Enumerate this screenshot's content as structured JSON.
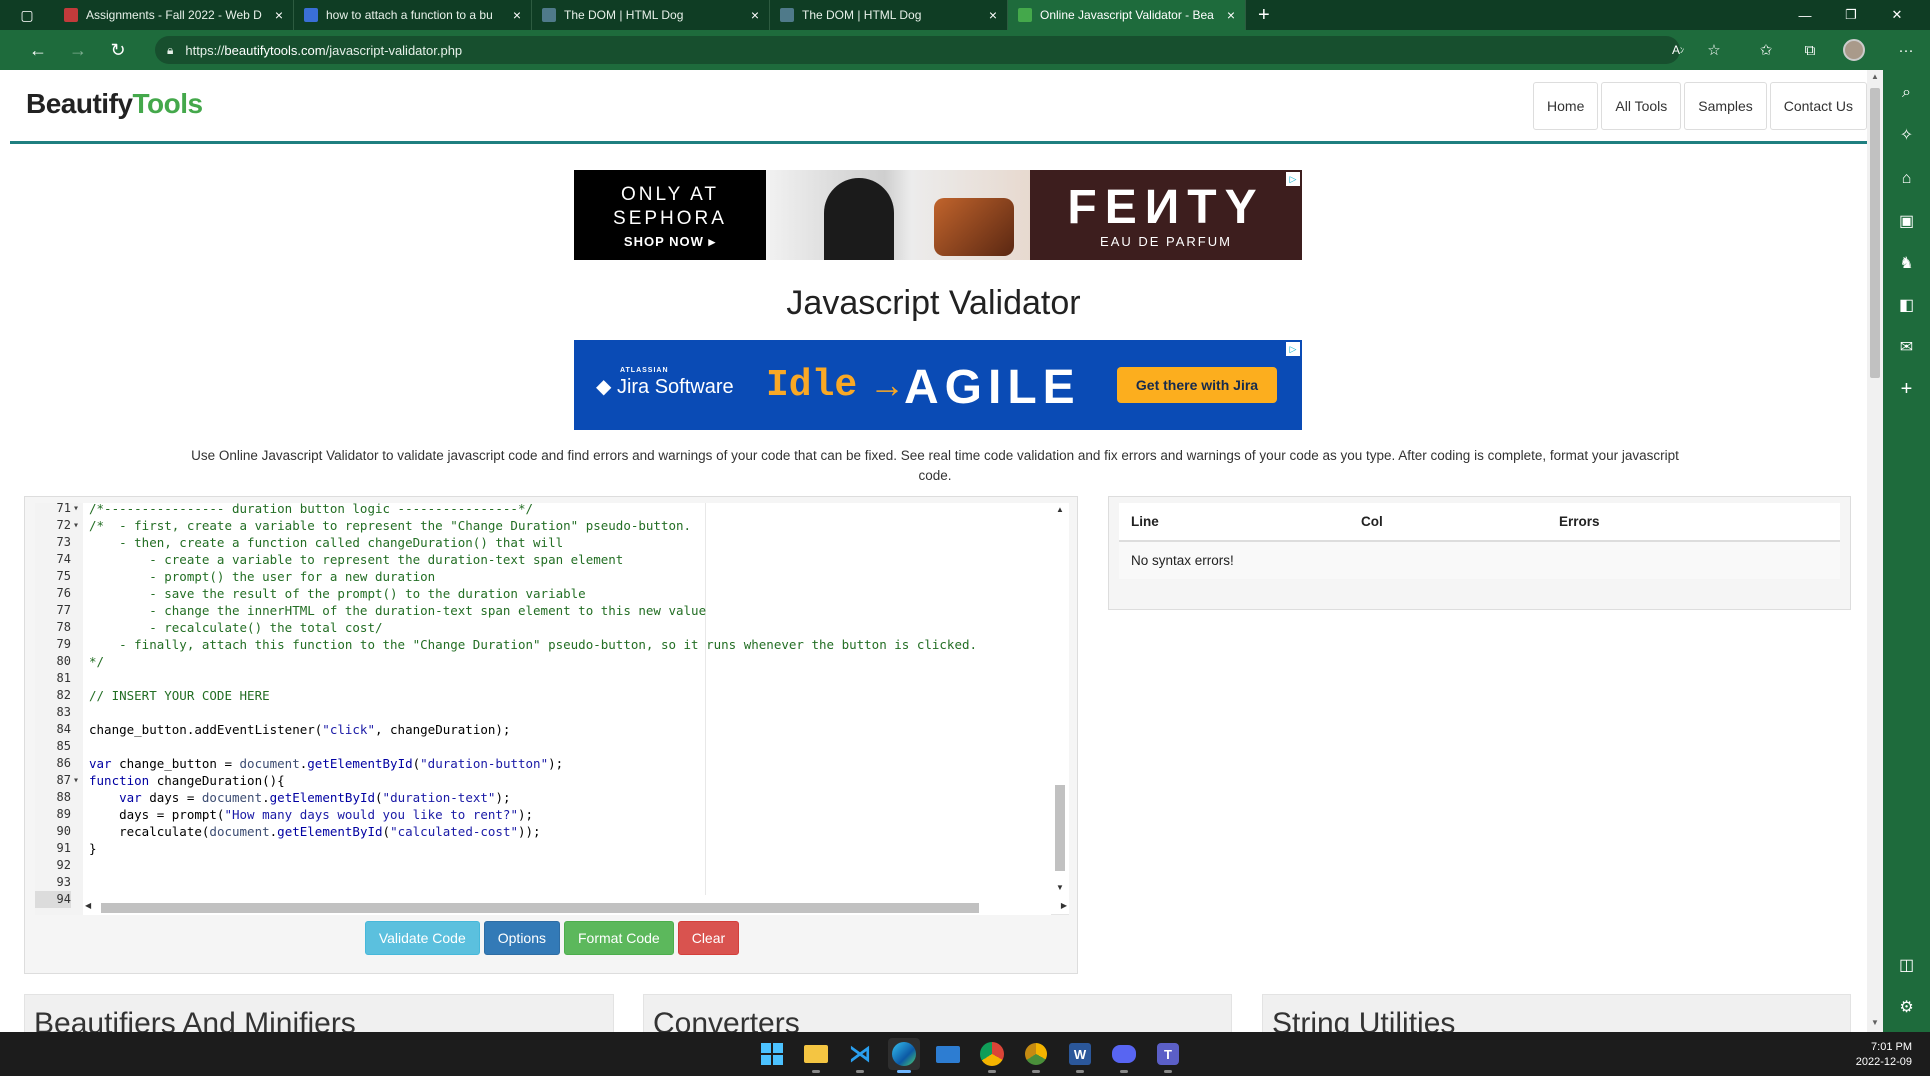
{
  "browser": {
    "tabs": [
      {
        "title": "Assignments - Fall 2022 - Web D",
        "favicon_color": "#c23b3b",
        "active": false
      },
      {
        "title": "how to attach a function to a bu",
        "favicon_color": "#3a6fd6",
        "active": false
      },
      {
        "title": "The DOM | HTML Dog",
        "favicon_color": "#4f7a8a",
        "active": false
      },
      {
        "title": "The DOM | HTML Dog",
        "favicon_color": "#4f7a8a",
        "active": false
      },
      {
        "title": "Online Javascript Validator - Bea",
        "favicon_color": "#44a84b",
        "active": true
      }
    ],
    "url_prefix": "https://",
    "url_host": "beautifytools.com",
    "url_path": "/javascript-validator.php"
  },
  "site": {
    "logo_part1": "Beautify",
    "logo_part2": "Tools",
    "nav": [
      "Home",
      "All Tools",
      "Samples",
      "Contact Us"
    ]
  },
  "ads": {
    "ad1": {
      "line1": "ONLY AT",
      "line2": "SEPHORA",
      "line3": "SHOP NOW ▸",
      "brand": "FEИTY",
      "sub": "EAU DE PARFUM"
    },
    "ad2": {
      "atlassian": "ATLASSIAN",
      "product": "◆ Jira Software",
      "idle": "Idle",
      "arrow": "→",
      "agile": "AGILE",
      "cta": "Get there with Jira"
    }
  },
  "main": {
    "title": "Javascript Validator",
    "description": "Use Online Javascript Validator to validate javascript code and find errors and warnings of your code that can be fixed. See real time code validation and fix errors and warnings of your code as you type. After coding is complete, format your javascript code."
  },
  "editor": {
    "lines": [
      {
        "n": "71",
        "fold": "▾",
        "t": [
          [
            "c",
            "/*---------------- duration button logic ----------------*/"
          ]
        ]
      },
      {
        "n": "72",
        "fold": "▾",
        "t": [
          [
            "c",
            "/*  - first, create a variable to represent the \"Change Duration\" pseudo-button."
          ]
        ]
      },
      {
        "n": "73",
        "fold": "",
        "t": [
          [
            "c",
            "    - then, create a function called changeDuration() that will"
          ]
        ]
      },
      {
        "n": "74",
        "fold": "",
        "t": [
          [
            "c",
            "        - create a variable to represent the duration-text span element"
          ]
        ]
      },
      {
        "n": "75",
        "fold": "",
        "t": [
          [
            "c",
            "        - prompt() the user for a new duration"
          ]
        ]
      },
      {
        "n": "76",
        "fold": "",
        "t": [
          [
            "c",
            "        - save the result of the prompt() to the duration variable"
          ]
        ]
      },
      {
        "n": "77",
        "fold": "",
        "t": [
          [
            "c",
            "        - change the innerHTML of the duration-text span element to this new value"
          ]
        ]
      },
      {
        "n": "78",
        "fold": "",
        "t": [
          [
            "c",
            "        - recalculate() the total cost/"
          ]
        ]
      },
      {
        "n": "79",
        "fold": "",
        "t": [
          [
            "c",
            "    - finally, attach this function to the \"Change Duration\" pseudo-button, so it runs whenever the button is clicked."
          ]
        ]
      },
      {
        "n": "80",
        "fold": "",
        "t": [
          [
            "c",
            "*/"
          ]
        ]
      },
      {
        "n": "81",
        "fold": "",
        "t": []
      },
      {
        "n": "82",
        "fold": "",
        "t": [
          [
            "c",
            "// INSERT YOUR CODE HERE"
          ]
        ]
      },
      {
        "n": "83",
        "fold": "",
        "t": []
      },
      {
        "n": "84",
        "fold": "",
        "t": [
          [
            "p",
            "change_button.addEventListener("
          ],
          [
            "s",
            "\"click\""
          ],
          [
            "p",
            ", changeDuration);"
          ]
        ]
      },
      {
        "n": "85",
        "fold": "",
        "t": []
      },
      {
        "n": "86",
        "fold": "",
        "t": [
          [
            "k",
            "var"
          ],
          [
            "p",
            " change_button = "
          ],
          [
            "d",
            "document"
          ],
          [
            "p",
            "."
          ],
          [
            "f",
            "getElementById"
          ],
          [
            "p",
            "("
          ],
          [
            "s",
            "\"duration-button\""
          ],
          [
            "p",
            ");"
          ]
        ]
      },
      {
        "n": "87",
        "fold": "▾",
        "t": [
          [
            "k",
            "function"
          ],
          [
            "p",
            " changeDuration(){"
          ]
        ]
      },
      {
        "n": "88",
        "fold": "",
        "t": [
          [
            "p",
            "    "
          ],
          [
            "k",
            "var"
          ],
          [
            "p",
            " days = "
          ],
          [
            "d",
            "document"
          ],
          [
            "p",
            "."
          ],
          [
            "f",
            "getElementById"
          ],
          [
            "p",
            "("
          ],
          [
            "s",
            "\"duration-text\""
          ],
          [
            "p",
            ");"
          ]
        ]
      },
      {
        "n": "89",
        "fold": "",
        "t": [
          [
            "p",
            "    days = prompt("
          ],
          [
            "s",
            "\"How many days would you like to rent?\""
          ],
          [
            "p",
            ");"
          ]
        ]
      },
      {
        "n": "90",
        "fold": "",
        "t": [
          [
            "p",
            "    recalculate("
          ],
          [
            "d",
            "document"
          ],
          [
            "p",
            "."
          ],
          [
            "f",
            "getElementById"
          ],
          [
            "p",
            "("
          ],
          [
            "s",
            "\"calculated-cost\""
          ],
          [
            "p",
            "));"
          ]
        ]
      },
      {
        "n": "91",
        "fold": "",
        "t": [
          [
            "p",
            "}"
          ]
        ]
      },
      {
        "n": "92",
        "fold": "",
        "t": []
      },
      {
        "n": "93",
        "fold": "",
        "t": []
      },
      {
        "n": "94",
        "fold": "",
        "t": [],
        "current": true
      }
    ]
  },
  "buttons": {
    "validate": "Validate Code",
    "options": "Options",
    "format": "Format Code",
    "clear": "Clear"
  },
  "errors": {
    "headers": [
      "Line",
      "Col",
      "Errors"
    ],
    "message": "No syntax errors!"
  },
  "cards": [
    "Beautifiers And Minifiers",
    "Converters",
    "String Utilities"
  ],
  "taskbar": {
    "time": "7:01 PM",
    "date": "2022-12-09"
  },
  "icons": {
    "address_bar": [
      "read-aloud-icon",
      "add-favorite-icon",
      "favorites-icon",
      "collections-icon",
      "profile-avatar",
      "more-icon"
    ],
    "sidebar": [
      "search-icon",
      "discover-icon",
      "shopping-tag-icon",
      "tools-icon",
      "games-icon",
      "office-icon",
      "outlook-icon",
      "add-icon",
      "split-screen-icon",
      "settings-icon"
    ],
    "taskbar": [
      "windows-start-icon",
      "file-explorer-icon",
      "vscode-icon",
      "edge-icon",
      "mail-icon",
      "chrome-icon",
      "chrome-canary-icon",
      "word-icon",
      "discord-icon",
      "teams-icon"
    ]
  },
  "colors": {
    "brand_green": "#44a84b",
    "header_rule": "#1f7f80",
    "browser_green": "#1e6b3c"
  }
}
